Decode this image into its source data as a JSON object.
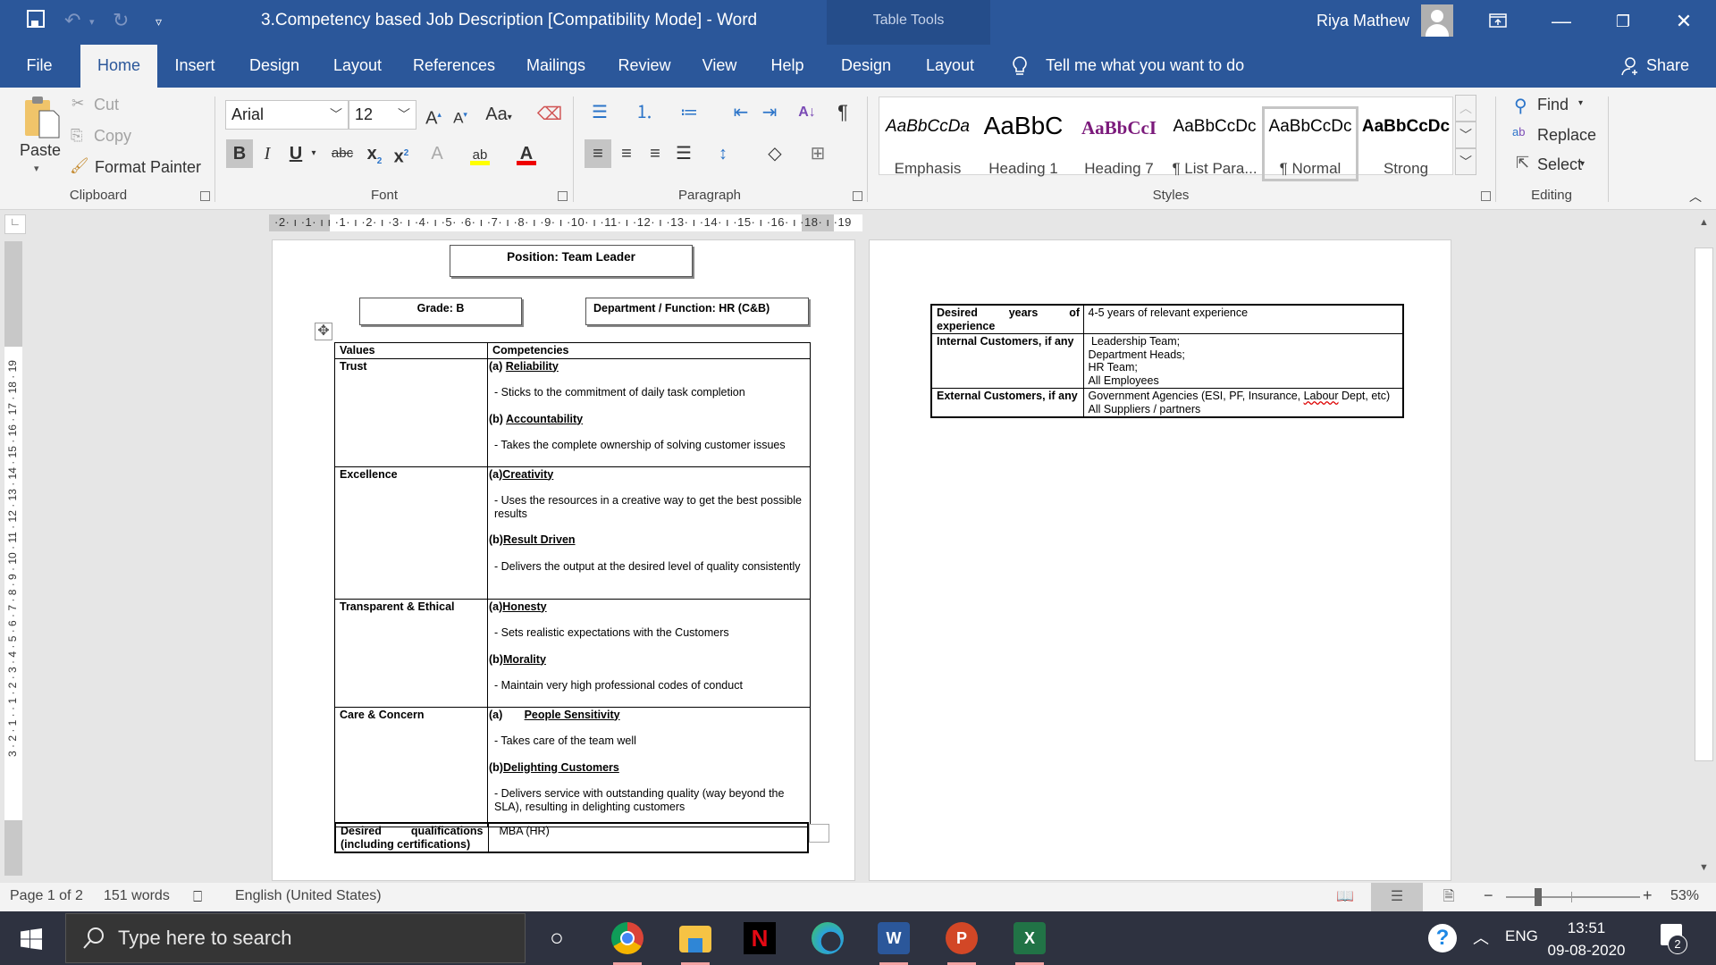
{
  "window": {
    "title": "3.Competency based Job Description [Compatibility Mode]  -  Word",
    "contextual_group": "Table Tools",
    "user_name": "Riya Mathew"
  },
  "tabs": [
    {
      "label": "File"
    },
    {
      "label": "Home"
    },
    {
      "label": "Insert"
    },
    {
      "label": "Design"
    },
    {
      "label": "Layout"
    },
    {
      "label": "References"
    },
    {
      "label": "Mailings"
    },
    {
      "label": "Review"
    },
    {
      "label": "View"
    },
    {
      "label": "Help"
    },
    {
      "label": "Design"
    },
    {
      "label": "Layout"
    }
  ],
  "tell_me": "Tell me what you want to do",
  "share_label": "Share",
  "ribbon": {
    "clipboard": {
      "label": "Clipboard",
      "paste": "Paste",
      "cut": "Cut",
      "copy": "Copy",
      "format_painter": "Format Painter"
    },
    "font": {
      "label": "Font",
      "font_name": "Arial",
      "font_size": "12",
      "change_case": "Aa"
    },
    "paragraph": {
      "label": "Paragraph"
    },
    "styles": {
      "label": "Styles",
      "items": [
        {
          "preview": "AaBbCcDa",
          "name": "Emphasis"
        },
        {
          "preview": "AaBbC",
          "name": "Heading 1"
        },
        {
          "preview": "AaBbCcI",
          "name": "Heading 7"
        },
        {
          "preview": "AaBbCcDc",
          "name": "¶ List Para..."
        },
        {
          "preview": "AaBbCcDc",
          "name": "¶ Normal"
        },
        {
          "preview": "AaBbCcDc",
          "name": "Strong"
        }
      ]
    },
    "editing": {
      "label": "Editing",
      "find": "Find",
      "replace": "Replace",
      "select": "Select"
    }
  },
  "ruler": {
    "horizontal": "·2· ı ·1· ı      ı ·1· ı ·2· ı ·3· ı ·4· ı ·5·      ·6· ı ·7· ı ·8· ı ·9· ı ·10· ı ·11· ı ·12· ı ·13· ı ·14· ı ·15· ı ·16· ı      ·18· ı ·19",
    "vertical": "3 · 2 · 1 · · 1 · 2 · 3 · 4 · 5 · 6 · 7 · 8 · 9 · 10 · 11 · 12 · 13 · 14 · 15 · 16 · 17 · 18 · 19"
  },
  "document": {
    "position": "Position:  Team Leader",
    "grade": "Grade: B",
    "department": "Department / Function:  HR (C&B)",
    "table_headers": {
      "values": "Values",
      "competencies": "Competencies"
    },
    "rows": [
      {
        "value": "Trust",
        "competencies": [
          {
            "prefix": "(a) ",
            "title": "Reliability",
            "desc": "- Sticks to the commitment of daily task completion"
          },
          {
            "prefix": "(b) ",
            "title": "Accountability",
            "desc": "- Takes the complete ownership of solving customer issues"
          }
        ]
      },
      {
        "value": "Excellence",
        "competencies": [
          {
            "prefix": "(a)",
            "title": "Creativity",
            "desc": "- Uses the resources in a creative way to get the best possible results"
          },
          {
            "prefix": "(b)",
            "title": "Result Driven",
            "desc": "- Delivers the output at the desired level of quality consistently"
          }
        ]
      },
      {
        "value": "Transparent & Ethical",
        "competencies": [
          {
            "prefix": "(a)",
            "title": "Honesty",
            "desc": "- Sets realistic expectations with the Customers"
          },
          {
            "prefix": "(b)",
            "title": "Morality",
            "desc": "- Maintain very high professional codes of conduct"
          }
        ]
      },
      {
        "value": "Care & Concern",
        "competencies": [
          {
            "prefix": "(a)       ",
            "title": "People Sensitivity",
            "desc": "- Takes care of the team well"
          },
          {
            "prefix": "(b)",
            "title": "Delighting Customers",
            "desc": "- Delivers service with outstanding quality (way beyond the SLA), resulting in delighting customers"
          }
        ]
      }
    ],
    "qualifications": {
      "label": "Desired qualifications (including certifications)",
      "value": "MBA (HR)"
    },
    "page2": [
      {
        "label": "Desired years of experience",
        "lines": [
          "4-5 years of relevant experience"
        ]
      },
      {
        "label": "Internal Customers, if any",
        "lines": [
          " Leadership Team;",
          "Department Heads;",
          "HR Team;",
          "All Employees"
        ]
      },
      {
        "label": "External Customers, if any",
        "lines_html": true,
        "line1_pre": "Government Agencies (ESI, PF, Insurance, ",
        "line1_spell": "Labour",
        "line1_post": " Dept, etc)",
        "line2": "All Suppliers / partners"
      }
    ]
  },
  "status": {
    "page": "Page 1 of 2",
    "words": "151 words",
    "language": "English (United States)",
    "zoom": "53%",
    "zoom_percent": 53
  },
  "taskbar": {
    "search_placeholder": "Type here to search",
    "language": "ENG",
    "time": "13:51",
    "date": "09-08-2020",
    "notification_count": "2",
    "apps": [
      "Cortana",
      "Chrome",
      "File Explorer",
      "Netflix",
      "Edge",
      "Word",
      "PowerPoint",
      "Excel"
    ]
  },
  "colors": {
    "word_blue": "#2b579a",
    "ribbon_bg": "#f3f3f3",
    "taskbar_bg": "#2e3240"
  }
}
